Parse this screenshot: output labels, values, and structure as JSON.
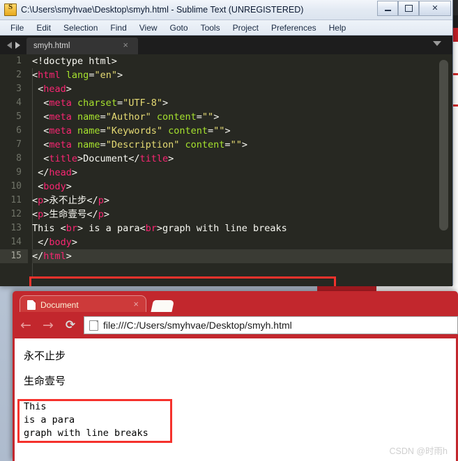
{
  "sublime": {
    "title": "C:\\Users\\smyhvae\\Desktop\\smyh.html - Sublime Text (UNREGISTERED)",
    "app_icon": "sublime-text-icon",
    "window_controls": {
      "minimize": "minimize-icon",
      "maximize": "maximize-icon",
      "close": "✕"
    },
    "menu": [
      "File",
      "Edit",
      "Selection",
      "Find",
      "View",
      "Goto",
      "Tools",
      "Project",
      "Preferences",
      "Help"
    ],
    "tab": {
      "label": "smyh.html",
      "close": "×",
      "prev_icon": "arrow-left-icon",
      "next_icon": "arrow-right-icon",
      "overflow_icon": "chevron-down-icon"
    },
    "code_lines": [
      {
        "n": "1",
        "segments": [
          {
            "t": "pn",
            "v": "<!doctype html>"
          }
        ]
      },
      {
        "n": "2",
        "segments": [
          {
            "t": "pn",
            "v": "<"
          },
          {
            "t": "tg",
            "v": "html"
          },
          {
            "t": "pn",
            "v": " "
          },
          {
            "t": "at",
            "v": "lang"
          },
          {
            "t": "pn",
            "v": "="
          },
          {
            "t": "st",
            "v": "\"en\""
          },
          {
            "t": "pn",
            "v": ">"
          }
        ]
      },
      {
        "n": "3",
        "segments": [
          {
            "t": "pn",
            "v": " <"
          },
          {
            "t": "tg",
            "v": "head"
          },
          {
            "t": "pn",
            "v": ">"
          }
        ]
      },
      {
        "n": "4",
        "segments": [
          {
            "t": "pn",
            "v": "  <"
          },
          {
            "t": "tg",
            "v": "meta"
          },
          {
            "t": "pn",
            "v": " "
          },
          {
            "t": "at",
            "v": "charset"
          },
          {
            "t": "pn",
            "v": "="
          },
          {
            "t": "st",
            "v": "\"UTF-8\""
          },
          {
            "t": "pn",
            "v": ">"
          }
        ]
      },
      {
        "n": "5",
        "segments": [
          {
            "t": "pn",
            "v": "  <"
          },
          {
            "t": "tg",
            "v": "meta"
          },
          {
            "t": "pn",
            "v": " "
          },
          {
            "t": "at",
            "v": "name"
          },
          {
            "t": "pn",
            "v": "="
          },
          {
            "t": "st",
            "v": "\"Author\""
          },
          {
            "t": "pn",
            "v": " "
          },
          {
            "t": "at",
            "v": "content"
          },
          {
            "t": "pn",
            "v": "="
          },
          {
            "t": "st",
            "v": "\"\""
          },
          {
            "t": "pn",
            "v": ">"
          }
        ]
      },
      {
        "n": "6",
        "segments": [
          {
            "t": "pn",
            "v": "  <"
          },
          {
            "t": "tg",
            "v": "meta"
          },
          {
            "t": "pn",
            "v": " "
          },
          {
            "t": "at",
            "v": "name"
          },
          {
            "t": "pn",
            "v": "="
          },
          {
            "t": "st",
            "v": "\"Keywords\""
          },
          {
            "t": "pn",
            "v": " "
          },
          {
            "t": "at",
            "v": "content"
          },
          {
            "t": "pn",
            "v": "="
          },
          {
            "t": "st",
            "v": "\"\""
          },
          {
            "t": "pn",
            "v": ">"
          }
        ]
      },
      {
        "n": "7",
        "segments": [
          {
            "t": "pn",
            "v": "  <"
          },
          {
            "t": "tg",
            "v": "meta"
          },
          {
            "t": "pn",
            "v": " "
          },
          {
            "t": "at",
            "v": "name"
          },
          {
            "t": "pn",
            "v": "="
          },
          {
            "t": "st",
            "v": "\"Description\""
          },
          {
            "t": "pn",
            "v": " "
          },
          {
            "t": "at",
            "v": "content"
          },
          {
            "t": "pn",
            "v": "="
          },
          {
            "t": "st",
            "v": "\"\""
          },
          {
            "t": "pn",
            "v": ">"
          }
        ]
      },
      {
        "n": "8",
        "segments": [
          {
            "t": "pn",
            "v": "  <"
          },
          {
            "t": "tg",
            "v": "title"
          },
          {
            "t": "pn",
            "v": ">"
          },
          {
            "t": "tx",
            "v": "Document"
          },
          {
            "t": "pn",
            "v": "</"
          },
          {
            "t": "tg",
            "v": "title"
          },
          {
            "t": "pn",
            "v": ">"
          }
        ]
      },
      {
        "n": "9",
        "segments": [
          {
            "t": "pn",
            "v": " </"
          },
          {
            "t": "tg",
            "v": "head"
          },
          {
            "t": "pn",
            "v": ">"
          }
        ]
      },
      {
        "n": "10",
        "segments": [
          {
            "t": "pn",
            "v": " <"
          },
          {
            "t": "tg",
            "v": "body"
          },
          {
            "t": "pn",
            "v": ">"
          }
        ]
      },
      {
        "n": "11",
        "segments": [
          {
            "t": "pn",
            "v": "<"
          },
          {
            "t": "tg",
            "v": "p"
          },
          {
            "t": "pn",
            "v": ">"
          },
          {
            "t": "tx",
            "v": "永不止步"
          },
          {
            "t": "pn",
            "v": "</"
          },
          {
            "t": "tg",
            "v": "p"
          },
          {
            "t": "pn",
            "v": ">"
          }
        ]
      },
      {
        "n": "12",
        "segments": [
          {
            "t": "pn",
            "v": "<"
          },
          {
            "t": "tg",
            "v": "p"
          },
          {
            "t": "pn",
            "v": ">"
          },
          {
            "t": "tx",
            "v": "生命壹号"
          },
          {
            "t": "pn",
            "v": "</"
          },
          {
            "t": "tg",
            "v": "p"
          },
          {
            "t": "pn",
            "v": ">"
          }
        ]
      },
      {
        "n": "13",
        "segments": [
          {
            "t": "tx",
            "v": "This <"
          },
          {
            "t": "tg",
            "v": "br"
          },
          {
            "t": "tx",
            "v": "> is a para<"
          },
          {
            "t": "tg",
            "v": "br"
          },
          {
            "t": "tx",
            "v": ">graph with line breaks"
          }
        ]
      },
      {
        "n": "14",
        "segments": [
          {
            "t": "pn",
            "v": " </"
          },
          {
            "t": "tg",
            "v": "body"
          },
          {
            "t": "pn",
            "v": ">"
          }
        ]
      },
      {
        "n": "15",
        "segments": [
          {
            "t": "pn",
            "v": "</"
          },
          {
            "t": "tg",
            "v": "html"
          },
          {
            "t": "pn",
            "v": ">"
          }
        ],
        "active": true
      }
    ],
    "annotation_color": "#f5322c"
  },
  "browser": {
    "tab": {
      "title": "Document",
      "close": "×",
      "favicon": "page-icon"
    },
    "new_tab_icon": "new-tab-icon",
    "nav": {
      "back": "←",
      "forward": "→",
      "reload": "⟳"
    },
    "omnibox": {
      "url": "file:///C:/Users/smyhvae/Desktop/smyh.html",
      "site_icon": "page-icon"
    },
    "page": {
      "paragraph1": "永不止步",
      "paragraph2": "生命壹号",
      "text_block": "This\nis a para\ngraph with line breaks"
    },
    "theme_color": "#c2272d"
  },
  "watermark": "CSDN @时雨h"
}
